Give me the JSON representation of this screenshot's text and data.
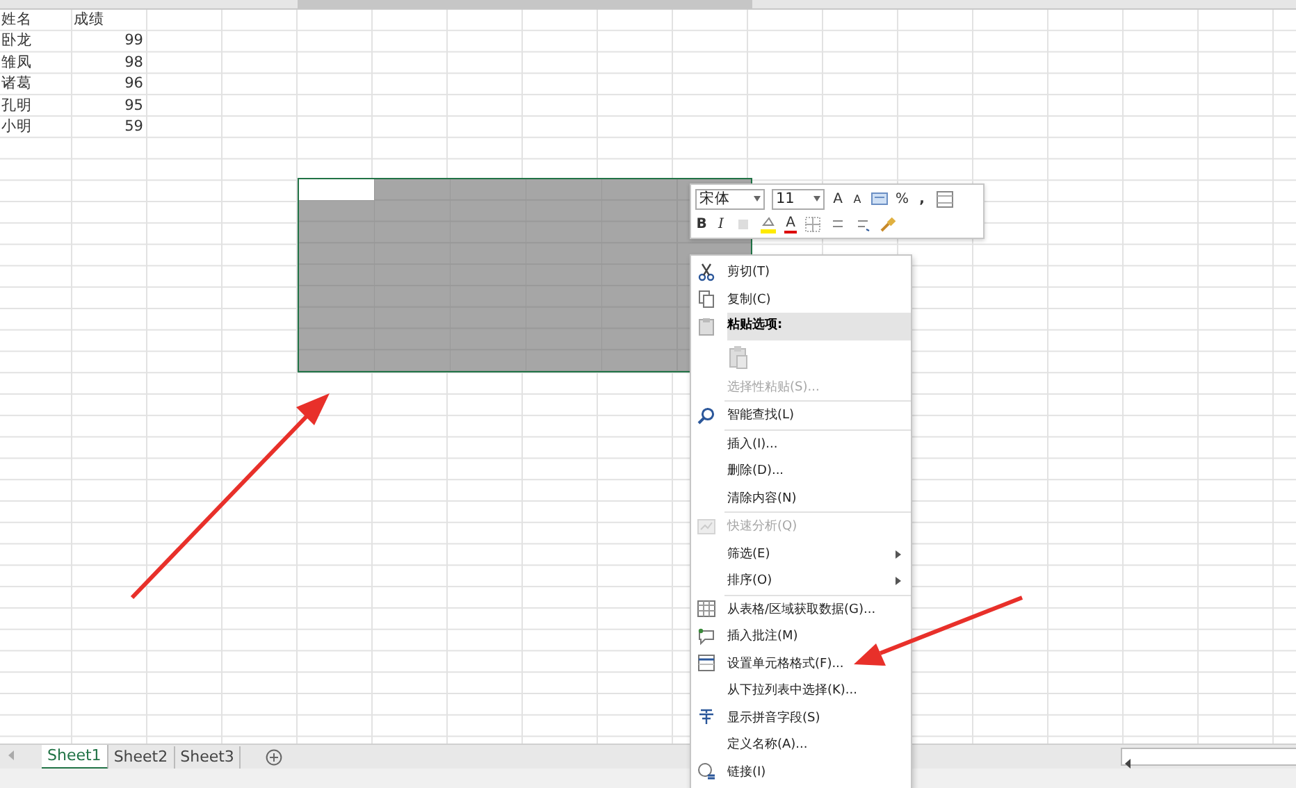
{
  "sheet": {
    "rows": [
      [
        "姓名",
        "成绩"
      ],
      [
        "卧龙",
        "99"
      ],
      [
        "雏凤",
        "98"
      ],
      [
        "诸葛",
        "96"
      ],
      [
        "孔明",
        "95"
      ],
      [
        "小明",
        "59"
      ]
    ]
  },
  "mini_toolbar": {
    "font": "宋体",
    "size": "11",
    "grow": "A",
    "shrink": "A",
    "percent": "%",
    "comma": ",",
    "bold": "B",
    "italic": "I",
    "font_color": "A"
  },
  "context_menu": {
    "items": [
      {
        "kind": "item",
        "label": "剪切(T)",
        "disabled": false,
        "submenu": false
      },
      {
        "kind": "item",
        "label": "复制(C)",
        "disabled": false,
        "submenu": false
      },
      {
        "kind": "header",
        "label": "粘贴选项:"
      },
      {
        "kind": "paste"
      },
      {
        "kind": "item",
        "label": "选择性粘贴(S)...",
        "disabled": true,
        "submenu": false
      },
      {
        "kind": "separator"
      },
      {
        "kind": "item",
        "label": "智能查找(L)",
        "disabled": false,
        "submenu": false
      },
      {
        "kind": "separator"
      },
      {
        "kind": "item",
        "label": "插入(I)...",
        "disabled": false,
        "submenu": false
      },
      {
        "kind": "item",
        "label": "删除(D)...",
        "disabled": false,
        "submenu": false
      },
      {
        "kind": "item",
        "label": "清除内容(N)",
        "disabled": false,
        "submenu": false
      },
      {
        "kind": "separator"
      },
      {
        "kind": "item",
        "label": "快速分析(Q)",
        "disabled": true,
        "submenu": false
      },
      {
        "kind": "item",
        "label": "筛选(E)",
        "disabled": false,
        "submenu": true
      },
      {
        "kind": "item",
        "label": "排序(O)",
        "disabled": false,
        "submenu": true
      },
      {
        "kind": "separator"
      },
      {
        "kind": "item",
        "label": "从表格/区域获取数据(G)...",
        "disabled": false,
        "submenu": false
      },
      {
        "kind": "item",
        "label": "插入批注(M)",
        "disabled": false,
        "submenu": false
      },
      {
        "kind": "item",
        "label": "设置单元格格式(F)...",
        "disabled": false,
        "submenu": false
      },
      {
        "kind": "item",
        "label": "从下拉列表中选择(K)...",
        "disabled": false,
        "submenu": false
      },
      {
        "kind": "item",
        "label": "显示拼音字段(S)",
        "disabled": false,
        "submenu": false
      },
      {
        "kind": "item",
        "label": "定义名称(A)...",
        "disabled": false,
        "submenu": false
      },
      {
        "kind": "item",
        "label": "链接(I)",
        "disabled": false,
        "submenu": false
      }
    ]
  },
  "sheet_tabs": [
    {
      "label": "Sheet1",
      "selected": true
    },
    {
      "label": "Sheet2",
      "selected": false
    },
    {
      "label": "Sheet3",
      "selected": false
    }
  ]
}
